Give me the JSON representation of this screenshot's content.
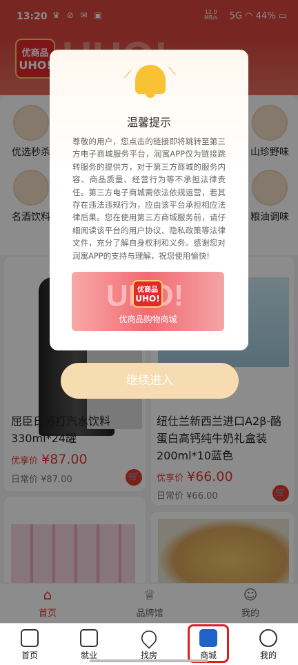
{
  "status_bar": {
    "time": "13:20",
    "net_speed_top": "12.0",
    "net_speed_unit": "MB/s",
    "net_type": "5G",
    "battery": "44%"
  },
  "header": {
    "logo_line1": "优商品",
    "logo_line2": "UHO!",
    "watermark": "UHO!"
  },
  "categories": [
    {
      "label": "优选秒杀"
    },
    {
      "label": "名酒饮料"
    },
    {
      "label": "山珍野味"
    },
    {
      "label": "粮油调味"
    }
  ],
  "products": [
    {
      "title": "屈臣氏苏打汽水饮料330ml*24罐",
      "price_label": "优享价",
      "price": "¥87.00",
      "daily_label": "日常价",
      "daily_price": "¥87.00"
    },
    {
      "title": "纽仕兰新西兰进口A2β-酪蛋白高钙纯牛奶礼盒装200ml*10蓝色",
      "price_label": "优享价",
      "price": "¥66.00",
      "daily_label": "日常价",
      "daily_price": "¥66.00"
    }
  ],
  "inner_tabs": [
    {
      "label": "首页"
    },
    {
      "label": "品牌馆"
    },
    {
      "label": "我的"
    }
  ],
  "dialog": {
    "title": "温馨提示",
    "body": "尊敬的用户，您点击的链接即将跳转至第三方电子商城服务平台，润寓APP仅为链接跳转服务的提供方，对于第三方商城的服务内容、商品质量、经营行为等不承担法律责任。第三方电子商城需依法依规运营，若其存在违法违规行为，应由该平台承担相应法律后果。您在使用第三方商城服务前，请仔细阅读该平台的用户协议、隐私政策等法律文件，充分了解自身权利和义务。感谢您对润寓APP的支持与理解，祝您使用愉快!",
    "banner_logo_line1": "优商品",
    "banner_logo_line2": "UHO!",
    "banner_watermark": "UHO!",
    "banner_text": "优商品购物商城",
    "continue_label": "继续进入"
  },
  "bottom_nav": [
    {
      "label": "首页",
      "icon": "home-icon"
    },
    {
      "label": "就业",
      "icon": "briefcase-icon"
    },
    {
      "label": "找房",
      "icon": "location-icon"
    },
    {
      "label": "商城",
      "icon": "shopping-bag-icon"
    },
    {
      "label": "我的",
      "icon": "person-icon"
    }
  ],
  "colors": {
    "brand_red": "#e23a2e",
    "active_blue": "#1f63c8",
    "highlight_red": "#e21b1b"
  }
}
